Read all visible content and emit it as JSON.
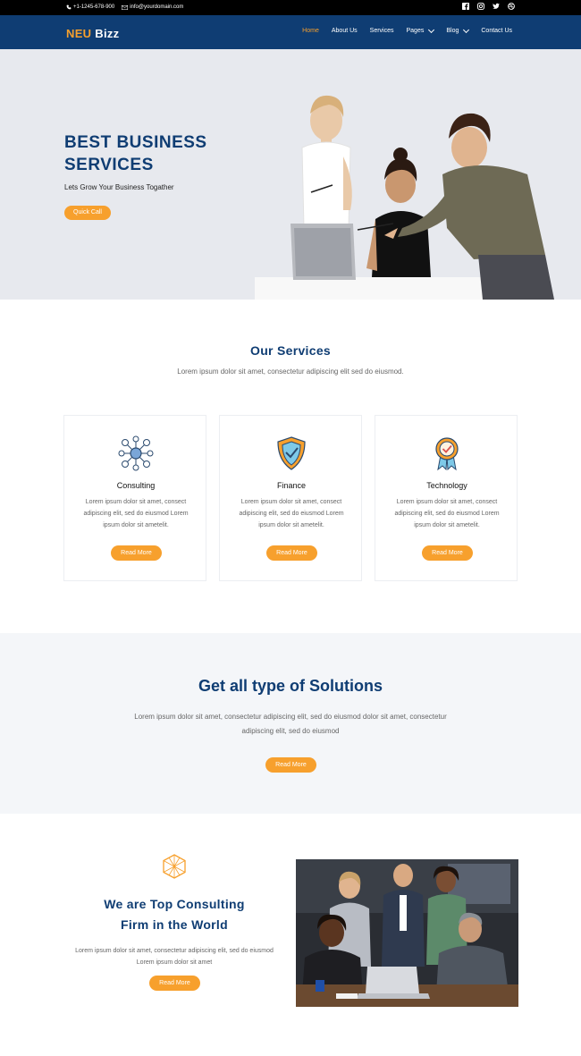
{
  "topbar": {
    "phone": "+1-1245-678-900",
    "email": "info@yourdomain.com",
    "social_icons": [
      "facebook-icon",
      "instagram-icon",
      "twitter-icon",
      "dribbble-icon"
    ]
  },
  "nav": {
    "brand_part1": "NEU",
    "brand_part2": "Bizz",
    "items": [
      {
        "label": "Home",
        "active": true
      },
      {
        "label": "About Us"
      },
      {
        "label": "Services"
      },
      {
        "label": "Pages",
        "dropdown": true
      },
      {
        "label": "Blog",
        "dropdown": true
      },
      {
        "label": "Contact Us"
      }
    ]
  },
  "hero": {
    "title_line1": "BEST BUSINESS",
    "title_line2": "SERVICES",
    "subtitle": "Lets Grow Your Business Togather",
    "button": "Quick Call"
  },
  "services": {
    "title": "Our Services",
    "subtitle": "Lorem ipsum dolor sit amet, consectetur adipiscing elit sed do eiusmod.",
    "cards": [
      {
        "title": "Consulting",
        "text": "Lorem ipsum dolor sit amet, consect adipiscing elit, sed do eiusmod Lorem ipsum dolor sit ametelit.",
        "button": "Read More",
        "icon": "network-icon"
      },
      {
        "title": "Finance",
        "text": "Lorem ipsum dolor sit amet, consect adipiscing elit, sed do eiusmod Lorem ipsum dolor sit ametelit.",
        "button": "Read More",
        "icon": "shield-check-icon"
      },
      {
        "title": "Technology",
        "text": "Lorem ipsum dolor sit amet, consect adipiscing elit, sed do eiusmod Lorem ipsum dolor sit ametelit.",
        "button": "Read More",
        "icon": "award-badge-icon"
      }
    ]
  },
  "solutions": {
    "title": "Get all type of Solutions",
    "text": "Lorem ipsum dolor sit amet, consectetur adipiscing elit, sed do eiusmod dolor sit amet, consectetur adipiscing elit, sed do eiusmod",
    "button": "Read More"
  },
  "consulting": {
    "title_line1": "We are Top Consulting",
    "title_line2": "Firm in the World",
    "text": "Lorem ipsum dolor sit amet, consectetur adipiscing elit, sed do eiusmod Lorem ipsum dolor sit amet",
    "button": "Read More"
  },
  "colors": {
    "primary": "#0f3d73",
    "accent": "#f7a02d"
  }
}
